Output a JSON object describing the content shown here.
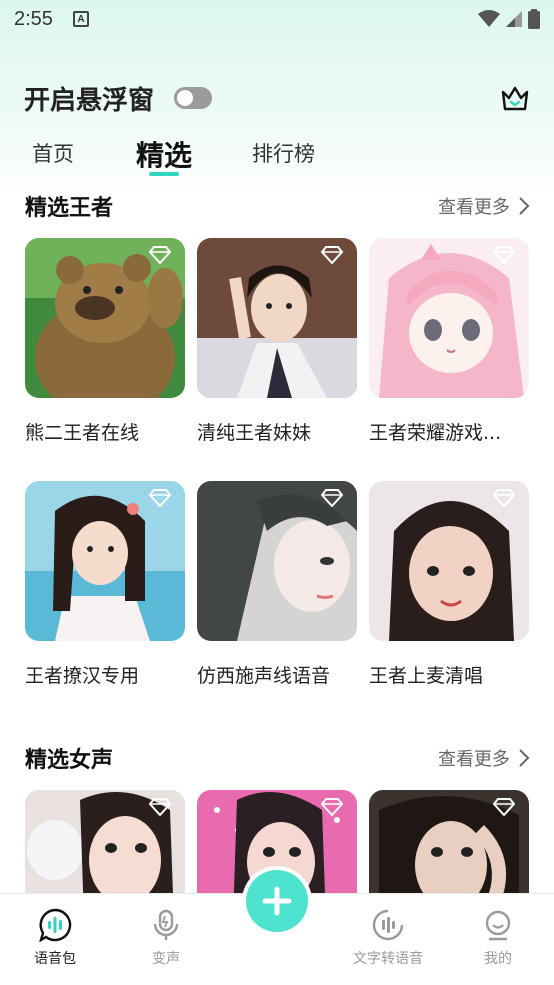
{
  "status_bar": {
    "time": "2:55",
    "notif": "A"
  },
  "header": {
    "float_window_label": "开启悬浮窗",
    "float_window_enabled": false
  },
  "tabs": [
    {
      "label": "首页",
      "active": false
    },
    {
      "label": "精选",
      "active": true
    },
    {
      "label": "排行榜",
      "active": false
    }
  ],
  "sections": [
    {
      "title": "精选王者",
      "more_label": "查看更多",
      "items": [
        {
          "title": "熊二王者在线"
        },
        {
          "title": "清纯王者妹妹"
        },
        {
          "title": "王者荣耀游戏..."
        },
        {
          "title": "王者撩汉专用"
        },
        {
          "title": "仿西施声线语音"
        },
        {
          "title": "王者上麦清唱"
        }
      ]
    },
    {
      "title": "精选女声",
      "more_label": "查看更多",
      "items": [
        {},
        {},
        {}
      ]
    }
  ],
  "bottom_nav": [
    {
      "label": "语音包",
      "icon": "voice-pack-icon",
      "active": true
    },
    {
      "label": "变声",
      "icon": "microphone-icon",
      "active": false
    },
    {
      "label": "文字转语音",
      "icon": "text-to-speech-icon",
      "active": false
    },
    {
      "label": "我的",
      "icon": "profile-icon",
      "active": false
    }
  ],
  "colors": {
    "accent": "#2ed6c0",
    "fab": "#4de3cf",
    "diamond": "#ffffff"
  }
}
